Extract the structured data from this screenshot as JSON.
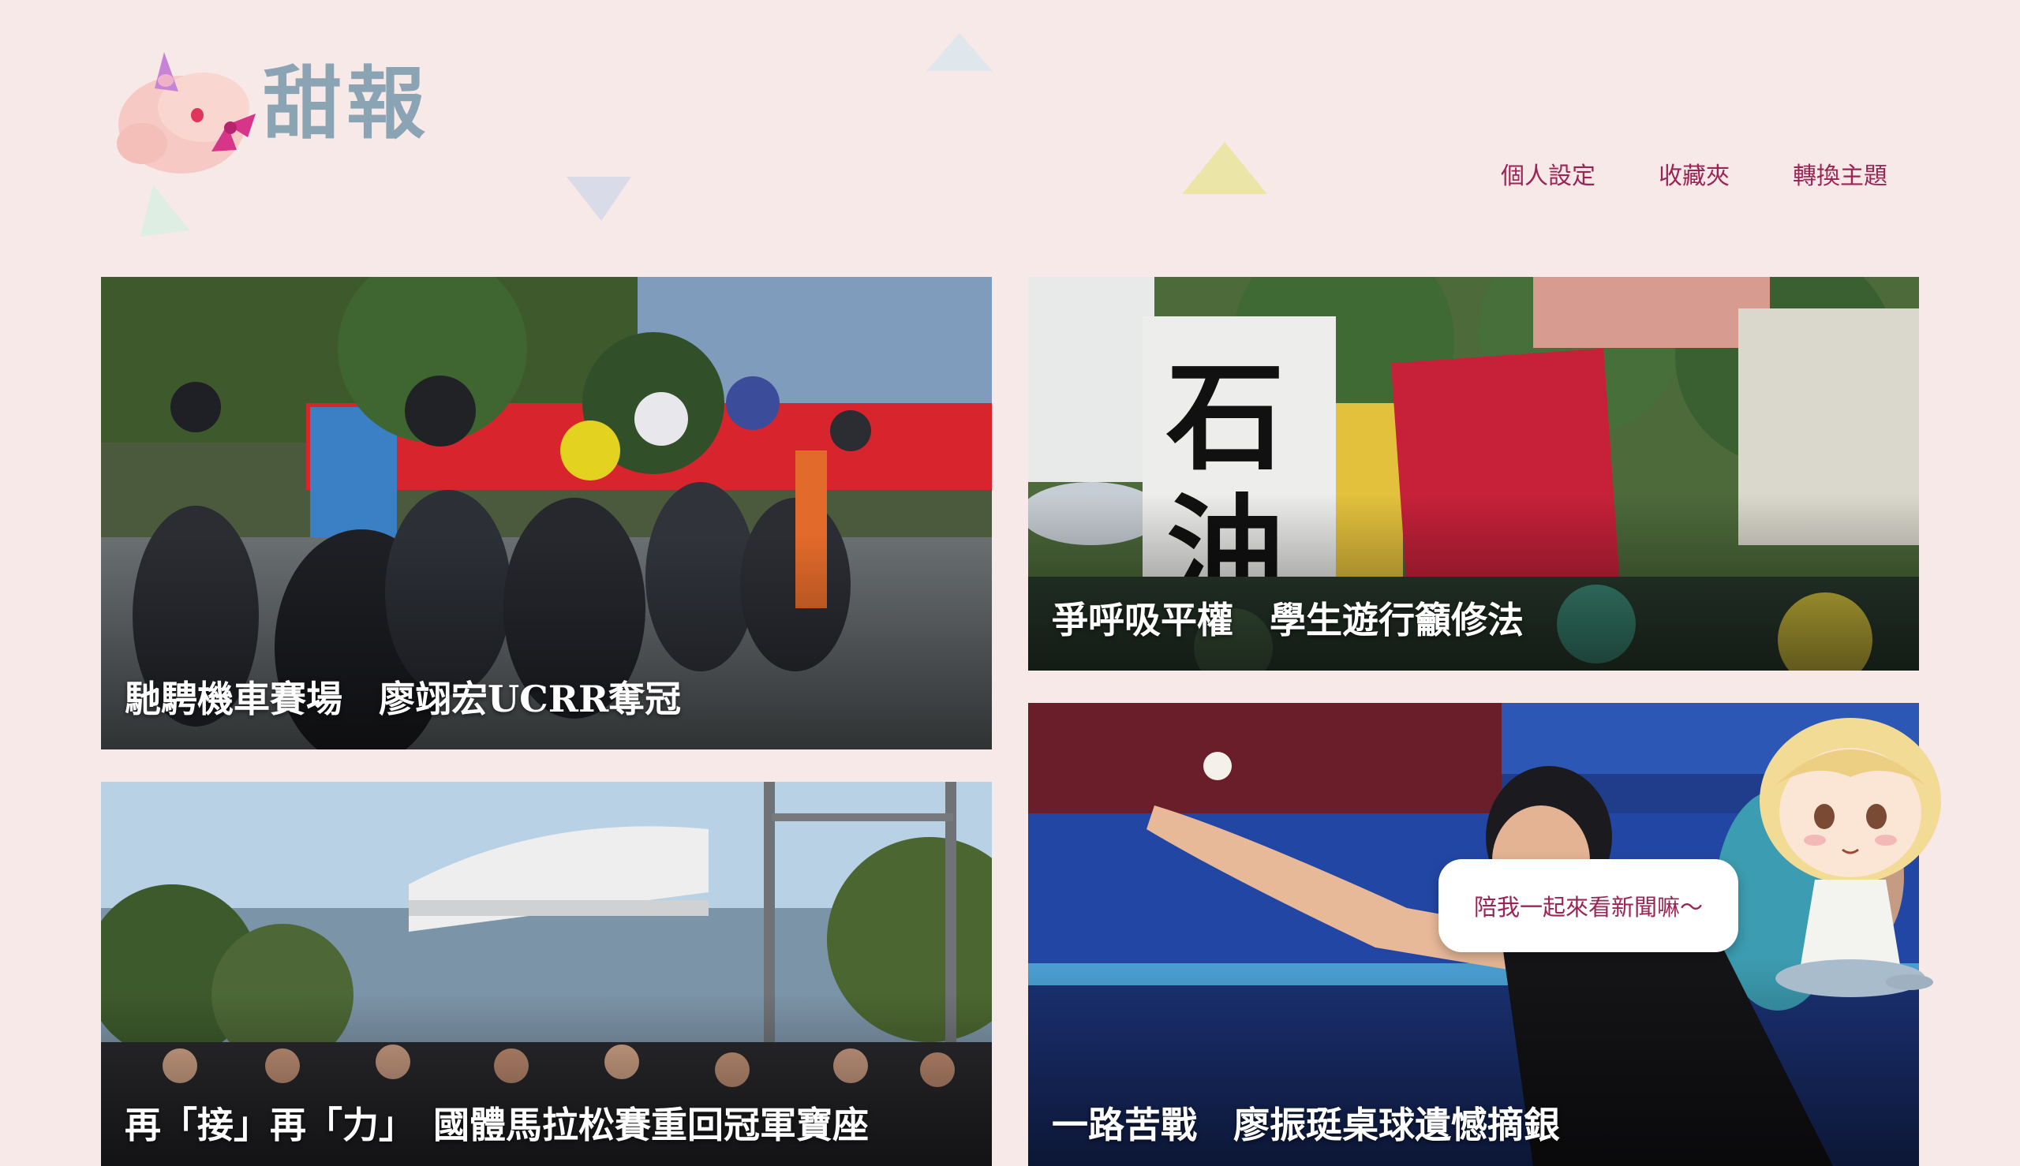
{
  "brand": {
    "name": "甜報",
    "logo_icon": "unicorn-pig-icon"
  },
  "nav": {
    "items": [
      {
        "label": "個人設定"
      },
      {
        "label": "收藏夾"
      },
      {
        "label": "轉換主題"
      }
    ]
  },
  "articles": [
    {
      "headline": "馳騁機車賽場　廖翊宏UCRR奪冠",
      "image": "motorcycle-race-photo"
    },
    {
      "headline": "爭呼吸平權　學生遊行籲修法",
      "image": "protest-signs-photo"
    },
    {
      "headline": "再「接」再「力」　國體馬拉松賽重回冠軍寶座",
      "image": "marathon-crowd-photo"
    },
    {
      "headline": "一路苦戰　廖振珽桌球遺憾摘銀",
      "image": "table-tennis-photo"
    }
  ],
  "mascot": {
    "bubble_text": "陪我一起來看新聞嘛～",
    "icon": "girl-mascot-icon"
  },
  "colors": {
    "background": "#f6e9e8",
    "accent": "#9b2456",
    "logo_text": "#8aa4b4"
  }
}
